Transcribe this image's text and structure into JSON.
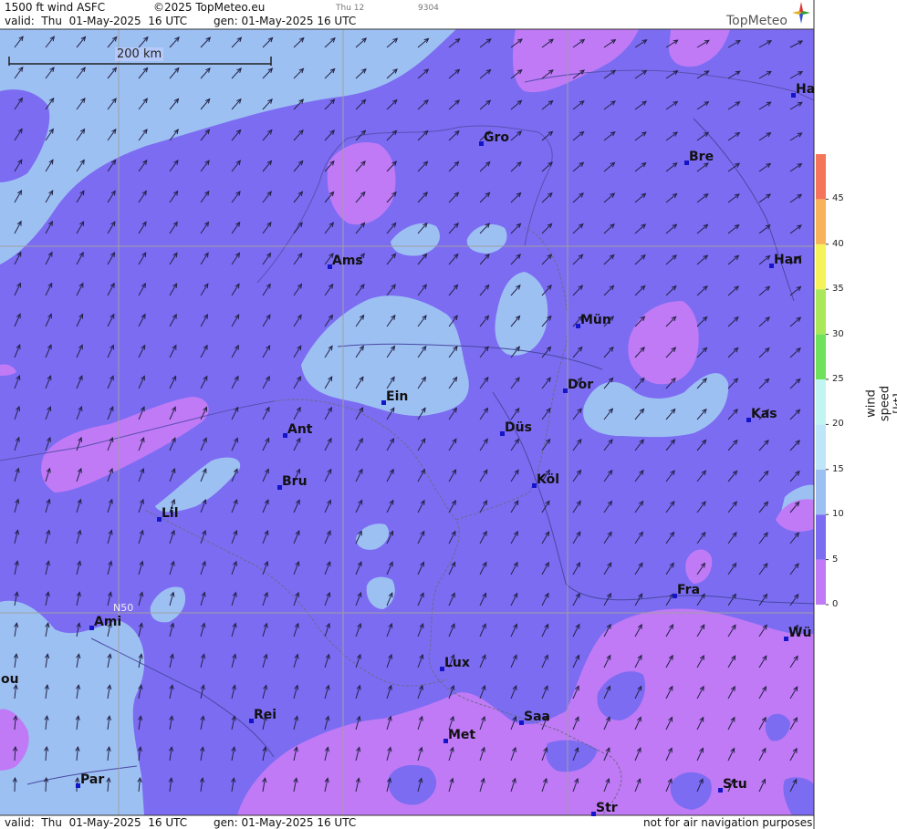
{
  "header": {
    "product": "1500 ft wind ASFC",
    "copyright": "©2025 TopMeteo.eu",
    "day_hour": "Thu 12",
    "code": "9304",
    "valid": "valid:  Thu  01-May-2025  16 UTC",
    "generated": "gen: 01-May-2025 16 UTC"
  },
  "footer": {
    "valid": "valid:  Thu  01-May-2025  16 UTC",
    "generated": "gen: 01-May-2025 16 UTC",
    "disclaimer": "not for air navigation purposes"
  },
  "logo": {
    "text": "TopMeteo"
  },
  "scale_bar": {
    "label": "200 km"
  },
  "latitude_label": "N50",
  "legend": {
    "title": "wind speed  [kt]",
    "ticks": [
      "0",
      "5",
      "10",
      "15",
      "20",
      "25",
      "30",
      "35",
      "40",
      "45"
    ],
    "colors": [
      "#c07af5",
      "#7c6cf2",
      "#9dc0f3",
      "#bfe6f8",
      "#c2f5f2",
      "#6ee25a",
      "#a8e85a",
      "#f6f25a",
      "#f8b25a",
      "#f4755a"
    ]
  },
  "colors": {
    "band_0_5": "#c07af5",
    "band_5_10": "#7c6cf2",
    "band_10_15": "#9dc0f3",
    "wind_arrow": "#222244",
    "city_marker": "#1414c8"
  },
  "cities": [
    {
      "label": "Gro"
    },
    {
      "label": "Bre"
    },
    {
      "label": "Ha"
    },
    {
      "label": "Han"
    },
    {
      "label": "Ams"
    },
    {
      "label": "Mün"
    },
    {
      "label": "Dor"
    },
    {
      "label": "Ein"
    },
    {
      "label": "Kas"
    },
    {
      "label": "Düs"
    },
    {
      "label": "Ant"
    },
    {
      "label": "Köl"
    },
    {
      "label": "Bru"
    },
    {
      "label": "Lil"
    },
    {
      "label": "Fra"
    },
    {
      "label": "Ami"
    },
    {
      "label": "Wü"
    },
    {
      "label": "Lux"
    },
    {
      "label": "ou"
    },
    {
      "label": "Rei"
    },
    {
      "label": "Saa"
    },
    {
      "label": "Met"
    },
    {
      "label": "Par"
    },
    {
      "label": "Stu"
    },
    {
      "label": "Str"
    }
  ]
}
